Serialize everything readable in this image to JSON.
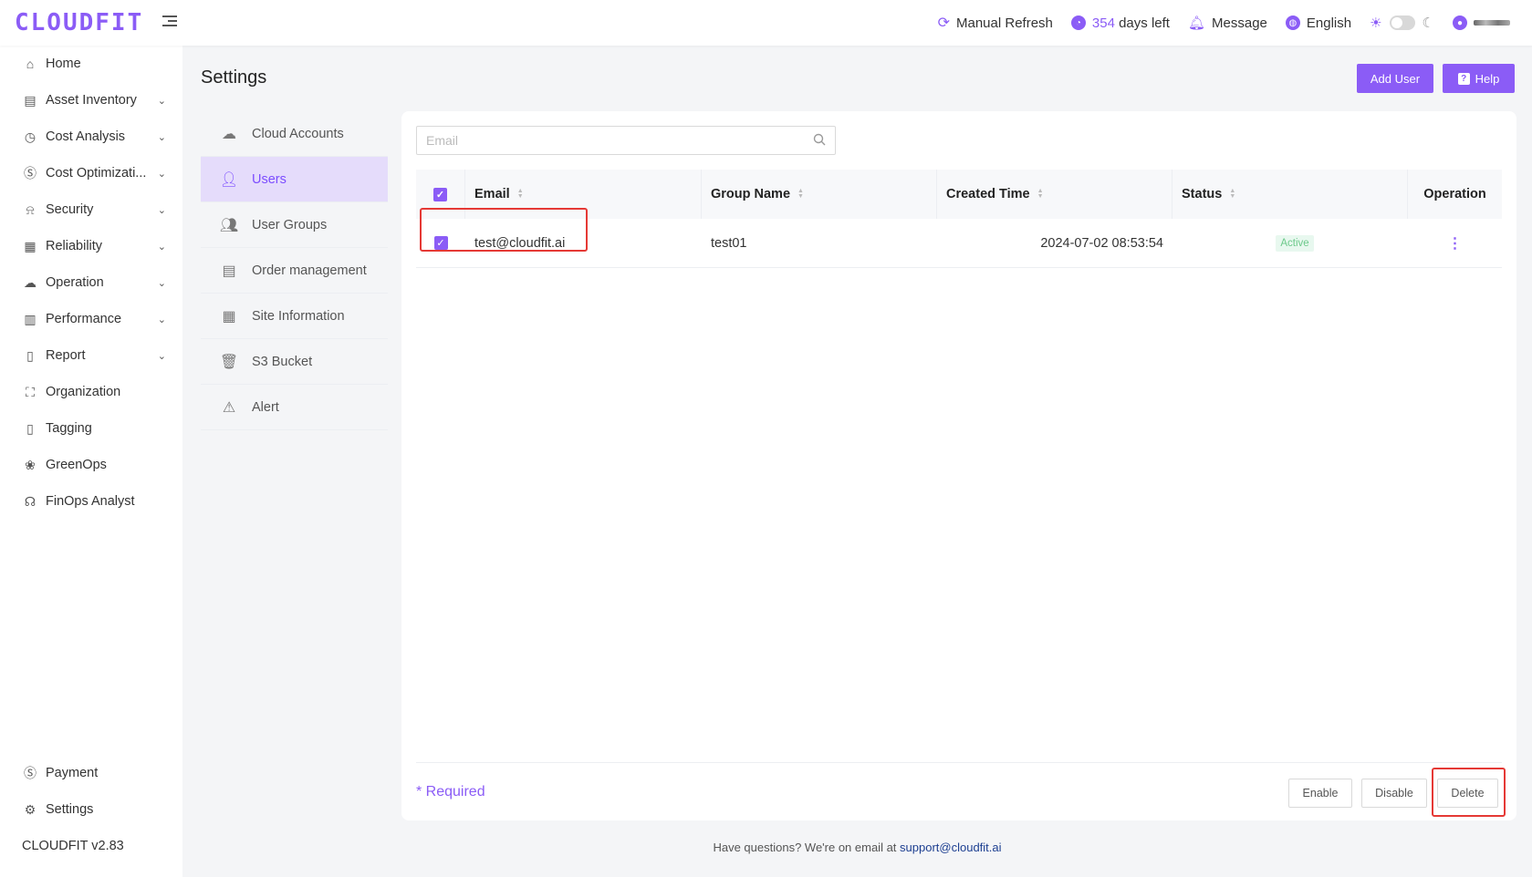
{
  "app": {
    "logo": "CLOUDFIT",
    "version": "CLOUDFIT v2.83"
  },
  "topbar": {
    "refresh_label": "Manual Refresh",
    "days_number": "354",
    "days_suffix": "days left",
    "message_label": "Message",
    "language_label": "English",
    "theme_mode": "light"
  },
  "sidebar": {
    "items": [
      {
        "label": "Home",
        "icon": "home-icon",
        "expandable": false
      },
      {
        "label": "Asset Inventory",
        "icon": "asset-icon",
        "expandable": true
      },
      {
        "label": "Cost Analysis",
        "icon": "gauge-icon",
        "expandable": true
      },
      {
        "label": "Cost Optimizati...",
        "icon": "dollar-icon",
        "expandable": true
      },
      {
        "label": "Security",
        "icon": "alarm-icon",
        "expandable": true
      },
      {
        "label": "Reliability",
        "icon": "reliability-icon",
        "expandable": true
      },
      {
        "label": "Operation",
        "icon": "operation-icon",
        "expandable": true
      },
      {
        "label": "Performance",
        "icon": "performance-icon",
        "expandable": true
      },
      {
        "label": "Report",
        "icon": "report-icon",
        "expandable": true
      },
      {
        "label": "Organization",
        "icon": "org-icon",
        "expandable": false
      },
      {
        "label": "Tagging",
        "icon": "tag-icon",
        "expandable": false
      },
      {
        "label": "GreenOps",
        "icon": "green-icon",
        "expandable": false
      },
      {
        "label": "FinOps Analyst",
        "icon": "analyst-icon",
        "expandable": false
      }
    ],
    "bottom": [
      {
        "label": "Payment",
        "icon": "dollar-icon"
      },
      {
        "label": "Settings",
        "icon": "gear-icon"
      }
    ]
  },
  "page": {
    "title": "Settings",
    "add_user_label": "Add User",
    "help_label": "Help"
  },
  "settings_nav": [
    {
      "label": "Cloud Accounts",
      "icon": "cloud-icon",
      "active": false
    },
    {
      "label": "Users",
      "icon": "user-icon",
      "active": true
    },
    {
      "label": "User Groups",
      "icon": "user-group-icon",
      "active": false
    },
    {
      "label": "Order management",
      "icon": "clipboard-icon",
      "active": false
    },
    {
      "label": "Site Information",
      "icon": "site-icon",
      "active": false
    },
    {
      "label": "S3 Bucket",
      "icon": "bucket-icon",
      "active": false
    },
    {
      "label": "Alert",
      "icon": "warning-icon",
      "active": false
    }
  ],
  "search": {
    "placeholder": "Email",
    "value": ""
  },
  "table": {
    "headers": {
      "email": "Email",
      "group": "Group Name",
      "created": "Created Time",
      "status": "Status",
      "operation": "Operation"
    },
    "rows": [
      {
        "checked": true,
        "email": "test@cloudfit.ai",
        "group": "test01",
        "created": "2024-07-02 08:53:54",
        "status": "Active"
      }
    ]
  },
  "footer": {
    "required_label": "* Required",
    "enable_label": "Enable",
    "disable_label": "Disable",
    "delete_label": "Delete"
  },
  "support": {
    "text": "Have questions? We're on email at",
    "email": "support@cloudfit.ai"
  },
  "colors": {
    "accent": "#8b5cf6",
    "active_bg": "#e5dcfb",
    "highlight": "#e53935",
    "status_active": "#6cc98a"
  }
}
